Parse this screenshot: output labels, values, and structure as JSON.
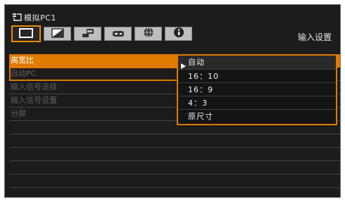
{
  "window": {
    "title": "模拟PC1"
  },
  "tabs": [
    {
      "icon": "screen-icon",
      "active": true
    },
    {
      "icon": "picture-adjust-icon",
      "active": false
    },
    {
      "icon": "installation-icon",
      "active": false
    },
    {
      "icon": "system-icon",
      "active": false
    },
    {
      "icon": "network-icon",
      "active": false
    },
    {
      "icon": "info-icon",
      "active": false
    }
  ],
  "tab_label": "输入设置",
  "menu": {
    "items": [
      {
        "label": "高宽比",
        "selected": true
      },
      {
        "label": "自动PC",
        "selected": false
      },
      {
        "label": "输入信号选择",
        "selected": false
      },
      {
        "label": "输入信号设置",
        "selected": false
      },
      {
        "label": "分屏",
        "selected": false
      }
    ]
  },
  "dropdown": {
    "current": "自动",
    "options": [
      "自动",
      "16：10",
      "16：9",
      "4：3",
      "原尺寸"
    ]
  },
  "colors": {
    "accent": "#e07a00",
    "background": "#1c1c1c",
    "disabled_text": "#5e5e5e"
  }
}
